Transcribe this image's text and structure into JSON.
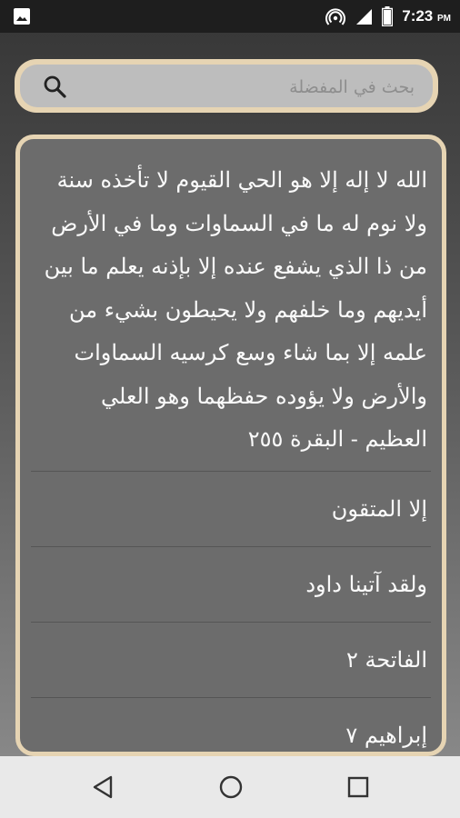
{
  "status_bar": {
    "time": "7:23",
    "ampm": "PM",
    "icons": [
      "image-icon",
      "hotspot-icon",
      "signal-icon",
      "battery-icon"
    ]
  },
  "search": {
    "placeholder": "بحث في المفضلة",
    "value": "",
    "icon": "search-icon"
  },
  "favorites": [
    {
      "text": "الله لا إله إلا هو الحي القيوم لا تأخذه سنة ولا نوم له ما في السماوات وما في الأرض من ذا الذي يشفع عنده إلا بإذنه يعلم ما بين أيديهم وما خلفهم ولا يحيطون بشيء من علمه إلا بما شاء وسع كرسيه السماوات والأرض ولا يؤوده حفظهما وهو العلي العظيم - البقرة ٢٥٥"
    },
    {
      "text": "إلا المتقون"
    },
    {
      "text": "ولقد آتينا داود"
    },
    {
      "text": "الفاتحة ٢"
    },
    {
      "text": "إبراهيم ٧"
    }
  ],
  "colors": {
    "accent_border": "#e6d4b3",
    "card_bg": "#6c6c6c",
    "search_bg": "#bdbdbd",
    "text": "#fafafa"
  },
  "nav_bar": {
    "icons": [
      "back-icon",
      "home-icon",
      "recents-icon"
    ]
  }
}
